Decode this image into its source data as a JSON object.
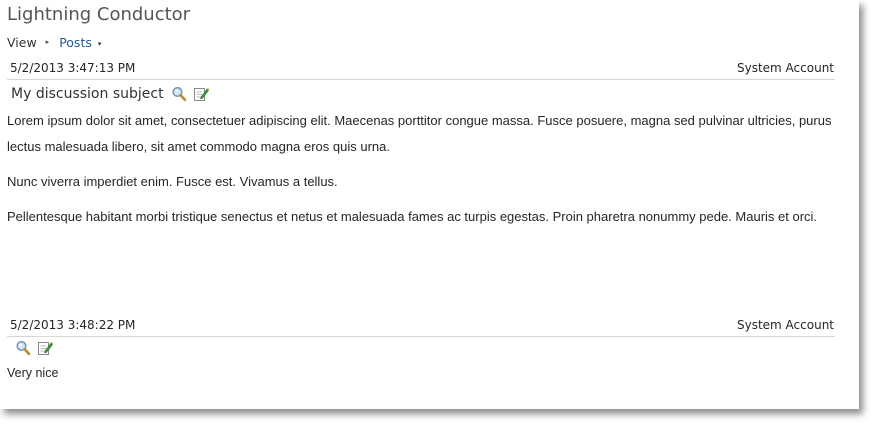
{
  "app": {
    "title": "Lightning Conductor"
  },
  "breadcrumb": {
    "view_label": "View",
    "separator": "▸",
    "posts_label": "Posts",
    "dropdown_glyph": "▾"
  },
  "posts": [
    {
      "timestamp": "5/2/2013 3:47:13 PM",
      "author": "System Account",
      "subject": "My discussion subject",
      "icons": [
        "magnifier-icon",
        "edit-icon"
      ],
      "paragraphs": [
        "Lorem ipsum dolor sit amet, consectetuer adipiscing elit. Maecenas porttitor congue massa. Fusce posuere, magna sed pulvinar ultricies, purus lectus malesuada libero, sit amet commodo magna eros quis urna.",
        "Nunc viverra imperdiet enim. Fusce est. Vivamus a tellus.",
        "Pellentesque habitant morbi tristique senectus et netus et malesuada fames ac turpis egestas. Proin pharetra nonummy pede. Mauris et orci."
      ]
    },
    {
      "timestamp": "5/2/2013 3:48:22 PM",
      "author": "System Account",
      "icons": [
        "magnifier-icon",
        "edit-icon"
      ],
      "body": "Very nice"
    }
  ],
  "colors": {
    "link": "#1f5a92",
    "divider": "#d6d6d6",
    "title": "#555555"
  }
}
